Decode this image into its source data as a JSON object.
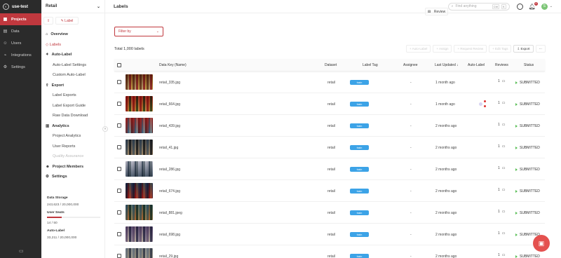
{
  "rail": {
    "workspace": "use-test",
    "items": [
      {
        "label": "Projects",
        "icon": "grid-icon",
        "active": true
      },
      {
        "label": "Data",
        "icon": "database-icon",
        "active": false
      },
      {
        "label": "Users",
        "icon": "user-icon",
        "active": false
      },
      {
        "label": "Integrations",
        "icon": "plug-icon",
        "active": false
      },
      {
        "label": "Settings",
        "icon": "gear-icon",
        "active": false
      }
    ]
  },
  "sidebar": {
    "project": "Retail",
    "btn_label": "Label",
    "btn_review": "Review",
    "overview": "Overview",
    "labels": "Labels",
    "auto_label": "Auto-Label",
    "auto_label_settings": "Auto-Label Settings",
    "custom_auto_label": "Custom Auto-Label",
    "export": "Export",
    "label_exports": "Label Exports",
    "label_export_guide": "Label Export Guide",
    "raw_data_download": "Raw Data Download",
    "analytics": "Analytics",
    "project_analytics": "Project Analytics",
    "user_reports": "User Reports",
    "quality_assurance": "Quality Assurance",
    "project_members": "Project Members",
    "settings": "Settings",
    "usage": {
      "data_storage_label": "Data Storage",
      "data_storage_value": "243,623 / 20,000,000",
      "user_seats_label": "User Seats",
      "user_seats_value": "14 / 50",
      "user_seats_fraction": 0.28,
      "auto_label_label": "Auto-Label",
      "auto_label_value": "33,211 / 20,000,000"
    }
  },
  "header": {
    "title": "Labels",
    "search_placeholder": "Find anything",
    "search_key1": "Ctrl",
    "search_key2": "K",
    "notif_count": "4",
    "avatar_initial": "S"
  },
  "filter": {
    "label": "Filter by"
  },
  "total": "Total 1,000 labels",
  "actions": {
    "auto_label": "+ Auto-Label",
    "assign": "+ Assign",
    "request_review": "+ Request Review",
    "edit_tags": "+ Edit Tags",
    "export": "Export",
    "more": "···"
  },
  "table": {
    "headers": {
      "data_key": "Data Key (Name)",
      "dataset": "Dataset",
      "label_tag": "Label Tag",
      "assignee": "Assignee",
      "last_updated": "Last Updated ↓",
      "auto_label": "Auto-Label",
      "reviews": "Reviews",
      "status": "Status"
    },
    "rows": [
      {
        "name": "retail_335.jpg",
        "dataset": "retail",
        "tag": "train",
        "assignee": "-",
        "updated": "1 month ago",
        "reviews": "1",
        "status": "SUBMITTED",
        "auto": false
      },
      {
        "name": "retail_664.jpg",
        "dataset": "retail",
        "tag": "train",
        "assignee": "-",
        "updated": "1 month ago",
        "reviews": "1",
        "status": "SUBMITTED",
        "auto": true
      },
      {
        "name": "retail_439.jpg",
        "dataset": "retail",
        "tag": "train",
        "assignee": "-",
        "updated": "2 months ago",
        "reviews": "1",
        "status": "SUBMITTED",
        "auto": false
      },
      {
        "name": "retail_41.jpg",
        "dataset": "retail",
        "tag": "train",
        "assignee": "-",
        "updated": "2 months ago",
        "reviews": "1",
        "status": "SUBMITTED",
        "auto": false
      },
      {
        "name": "retail_286.jpg",
        "dataset": "retail",
        "tag": "train",
        "assignee": "-",
        "updated": "2 months ago",
        "reviews": "1",
        "status": "SUBMITTED",
        "auto": false
      },
      {
        "name": "retail_674.jpg",
        "dataset": "retail",
        "tag": "train",
        "assignee": "-",
        "updated": "2 months ago",
        "reviews": "1",
        "status": "SUBMITTED",
        "auto": false
      },
      {
        "name": "retail_881.jpeg",
        "dataset": "retail",
        "tag": "train",
        "assignee": "-",
        "updated": "2 months ago",
        "reviews": "1",
        "status": "SUBMITTED",
        "auto": false
      },
      {
        "name": "retail_698.jpg",
        "dataset": "retail",
        "tag": "train",
        "assignee": "-",
        "updated": "2 months ago",
        "reviews": "1",
        "status": "SUBMITTED",
        "auto": false
      },
      {
        "name": "retail_29.jpg",
        "dataset": "retail",
        "tag": "train",
        "assignee": "-",
        "updated": "2 months ago",
        "reviews": "1",
        "status": "SUBMITTED",
        "auto": false
      }
    ]
  },
  "colors": {
    "accent": "#c0383e",
    "tag": "#3ca3e7",
    "status_ok": "#5bbf58"
  }
}
